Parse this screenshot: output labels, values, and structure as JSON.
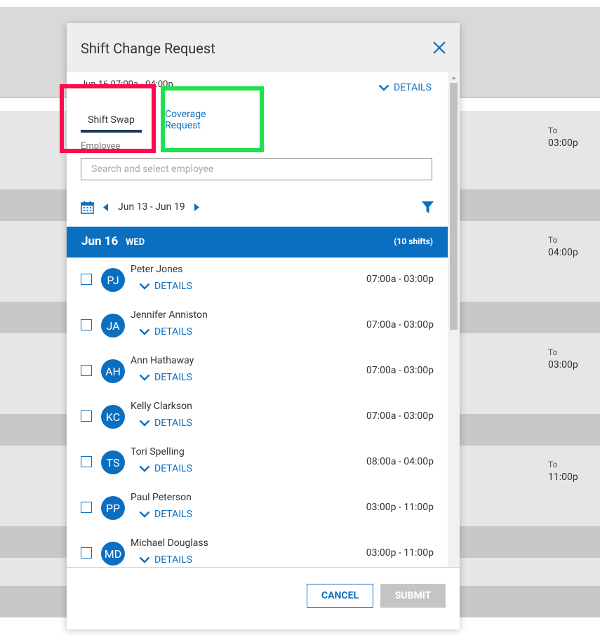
{
  "modal": {
    "title": "Shift Change Request",
    "top_details": "DETAILS",
    "hidden_row_text": "Jun 16 07:00a - 04:00p",
    "tabs": [
      {
        "label": "Shift Swap",
        "active": true
      },
      {
        "label": "Coverage Request",
        "active": false
      }
    ],
    "employee_label": "Employee",
    "search": {
      "placeholder": "Search and select employee",
      "value": ""
    },
    "date_range": "Jun 13 - Jun 19",
    "day": {
      "date": "Jun 16",
      "weekday": "WED",
      "count": "(10 shifts)"
    },
    "shifts": [
      {
        "initials": "PJ",
        "name": "Peter Jones",
        "details": "DETAILS",
        "time": "07:00a - 03:00p"
      },
      {
        "initials": "JA",
        "name": "Jennifer Anniston",
        "details": "DETAILS",
        "time": "07:00a - 03:00p"
      },
      {
        "initials": "AH",
        "name": "Ann Hathaway",
        "details": "DETAILS",
        "time": "07:00a - 03:00p"
      },
      {
        "initials": "KC",
        "name": "Kelly Clarkson",
        "details": "DETAILS",
        "time": "07:00a - 03:00p"
      },
      {
        "initials": "TS",
        "name": "Tori Spelling",
        "details": "DETAILS",
        "time": "08:00a - 04:00p"
      },
      {
        "initials": "PP",
        "name": "Paul Peterson",
        "details": "DETAILS",
        "time": "03:00p - 11:00p"
      },
      {
        "initials": "MD",
        "name": "Michael Douglass",
        "details": "DETAILS",
        "time": "03:00p - 11:00p"
      }
    ],
    "footer": {
      "cancel": "CANCEL",
      "submit": "SUBMIT"
    }
  },
  "background": {
    "to_items": [
      {
        "label": "To",
        "time": "03:00p"
      },
      {
        "label": "To",
        "time": "04:00p"
      },
      {
        "label": "To",
        "time": "03:00p"
      },
      {
        "label": "To",
        "time": "11:00p"
      }
    ]
  },
  "colors": {
    "accent": "#0b6fc1",
    "tab_underline": "#1a3a5c",
    "highlight_red": "#ff0a4e",
    "highlight_green": "#1fe04e",
    "submit_disabled": "#c4c4c4"
  },
  "icons": {
    "close": "close-icon",
    "calendar": "calendar-icon",
    "filter": "filter-icon",
    "chevron": "chevron-down-icon"
  }
}
